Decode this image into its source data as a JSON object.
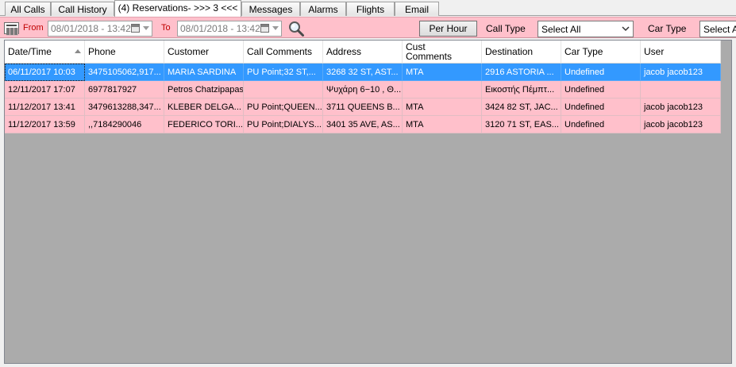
{
  "tabs": [
    {
      "label": "All Calls"
    },
    {
      "label": "Call History"
    },
    {
      "label": "(4) Reservations- >>> 3 <<<"
    },
    {
      "label": "Messages"
    },
    {
      "label": "Alarms"
    },
    {
      "label": "Flights"
    },
    {
      "label": "Email"
    }
  ],
  "toolbar": {
    "from_label": "From",
    "from_date": "08/01/2018 - 13:42",
    "to_label": "To",
    "to_date": "08/01/2018 - 13:42",
    "per_hour_label": "Per Hour",
    "call_type_label": "Call Type",
    "call_type_value": "Select All",
    "car_type_label": "Car Type",
    "car_type_value": "Select All"
  },
  "grid": {
    "columns": [
      "Date/Time",
      "Phone",
      "Customer",
      "Call Comments",
      "Address",
      "Cust\nComments",
      "Destination",
      "Car Type",
      "User"
    ],
    "rows": [
      [
        "06/11/2017 10:03",
        "3475105062,917...",
        "MARIA SARDINA",
        "PU Point;32 ST,...",
        "3268 32 ST, AST...",
        "MTA",
        "2916 ASTORIA ...",
        "Undefined",
        "jacob jacob123"
      ],
      [
        "12/11/2017 17:07",
        "6977817927",
        "Petros Chatzipapas",
        "",
        "Ψυχάρη 6−10 , Θ...",
        "",
        "Εικοστής Πέμπτ...",
        "Undefined",
        ""
      ],
      [
        "11/12/2017 13:41",
        "3479613288,347...",
        "KLEBER DELGA...",
        "PU Point;QUEEN...",
        "3711 QUEENS B...",
        "MTA",
        "3424 82 ST, JAC...",
        "Undefined",
        "jacob jacob123"
      ],
      [
        "11/12/2017 13:59",
        ",,7184290046",
        "FEDERICO TORI...",
        "PU Point;DIALYS...",
        "3401 35 AVE, AS...",
        "MTA",
        "3120 71 ST, EAS...",
        "Undefined",
        "jacob jacob123"
      ]
    ]
  },
  "colors": {
    "row_bg": "#ffc0cb",
    "selected_row_bg": "#3399ff",
    "toolbar_bg": "#ffc0cb",
    "grid_empty_bg": "#ababab"
  }
}
